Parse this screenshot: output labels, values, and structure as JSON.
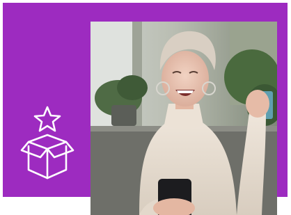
{
  "panel": {
    "color": "#9d2bc0"
  },
  "photo": {
    "subject": "woman-celebrating-with-phone"
  },
  "icon": {
    "name": "gift-box-star-icon",
    "color": "#ffffff"
  }
}
